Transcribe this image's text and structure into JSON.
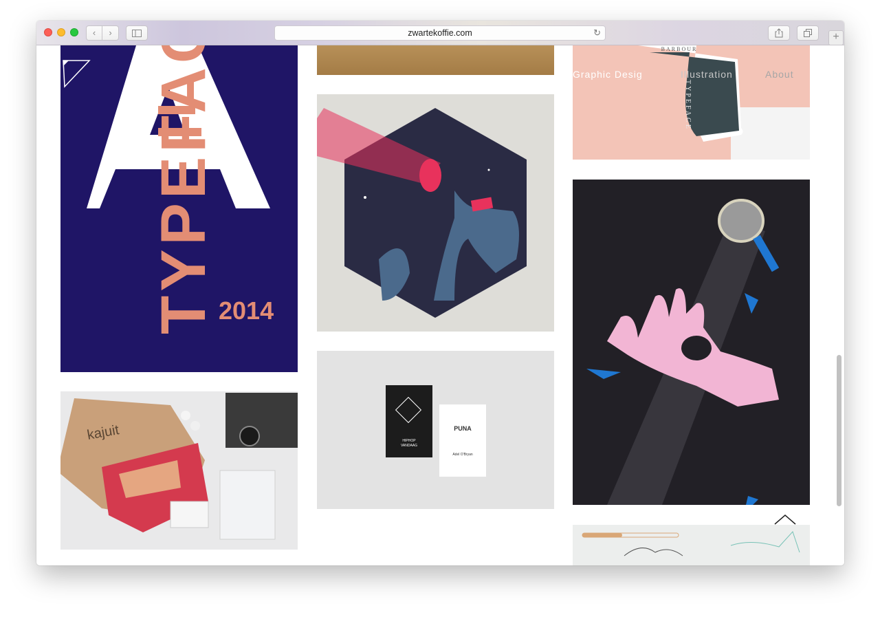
{
  "browser": {
    "url": "zwartekoffie.com",
    "back_icon": "chevron-left-icon",
    "forward_icon": "chevron-right-icon",
    "reload_icon": "reload-icon",
    "new_tab_label": "+"
  },
  "site": {
    "nav": {
      "graphic_design": "Graphic Desig",
      "illustration": "Illustration",
      "about": "About"
    }
  },
  "portfolio": {
    "typeface_poster": {
      "letter": "A",
      "word": "TYPEFACE",
      "year": "2014"
    },
    "barbour_sheet": {
      "top_text": "BARBOUR",
      "side_text": "TYPEFACE"
    },
    "business_cards": {
      "card1_line1": "HIPHOP",
      "card1_line2": "VANDAAG",
      "card2_brand": "PUNA",
      "card2_name": "Adel O'Bryan"
    },
    "bag_tile": {
      "brand_text": "kajuit"
    }
  },
  "colors": {
    "poster_bg": "#1f1566",
    "poster_accent": "#e38d74",
    "hand_bg": "#222026",
    "hand_pink": "#f2b5d4",
    "hex_dark": "#2a2b44",
    "beam_red": "#e8325c"
  }
}
